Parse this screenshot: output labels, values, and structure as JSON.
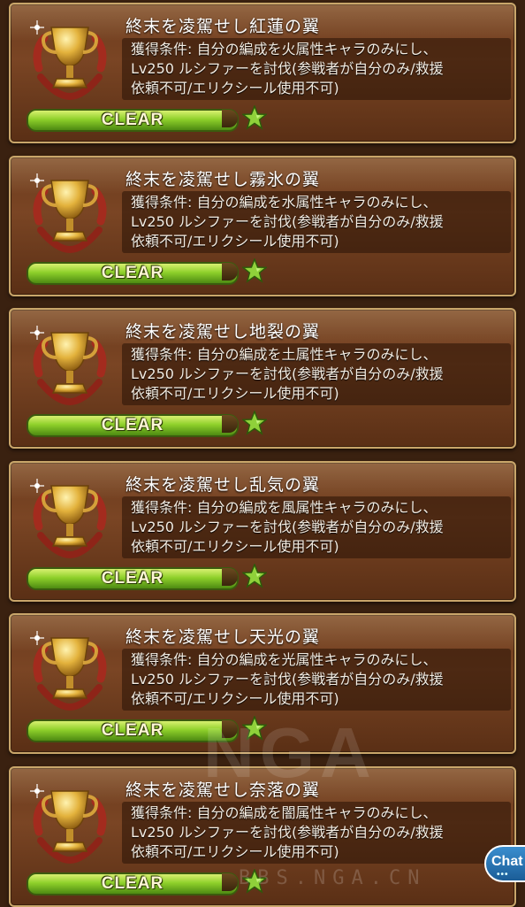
{
  "achievements": [
    {
      "title": "終末を凌駕せし紅蓮の翼",
      "description": "獲得条件: 自分の編成を火属性キャラのみにし、\nLv250 ルシファーを討伐(参戦者が自分のみ/救援\n依頼不可/エリクシール使用不可)",
      "status": "CLEAR"
    },
    {
      "title": "終末を凌駕せし霧氷の翼",
      "description": "獲得条件: 自分の編成を水属性キャラのみにし、\nLv250 ルシファーを討伐(参戦者が自分のみ/救援\n依頼不可/エリクシール使用不可)",
      "status": "CLEAR"
    },
    {
      "title": "終末を凌駕せし地裂の翼",
      "description": "獲得条件: 自分の編成を土属性キャラのみにし、\nLv250 ルシファーを討伐(参戦者が自分のみ/救援\n依頼不可/エリクシール使用不可)",
      "status": "CLEAR"
    },
    {
      "title": "終末を凌駕せし乱気の翼",
      "description": "獲得条件: 自分の編成を風属性キャラのみにし、\nLv250 ルシファーを討伐(参戦者が自分のみ/救援\n依頼不可/エリクシール使用不可)",
      "status": "CLEAR"
    },
    {
      "title": "終末を凌駕せし天光の翼",
      "description": "獲得条件: 自分の編成を光属性キャラのみにし、\nLv250 ルシファーを討伐(参戦者が自分のみ/救援\n依頼不可/エリクシール使用不可)",
      "status": "CLEAR"
    },
    {
      "title": "終末を凌駕せし奈落の翼",
      "description": "獲得条件: 自分の編成を闇属性キャラのみにし、\nLv250 ルシファーを討伐(参戦者が自分のみ/救援\n依頼不可/エリクシール使用不可)",
      "status": "CLEAR"
    }
  ],
  "icons": {
    "trophy": "trophy-icon",
    "star": "star-icon"
  },
  "colors": {
    "progress_green": "#8ed02a",
    "frame_gold": "#c9a66a",
    "card_brown": "#6b3a1c",
    "star_green": "#8fd13a"
  },
  "watermark": {
    "text": "NGA",
    "sub": "BBS.NGA.CN"
  },
  "chat_button": {
    "label": "Chat",
    "dots": "•••"
  }
}
